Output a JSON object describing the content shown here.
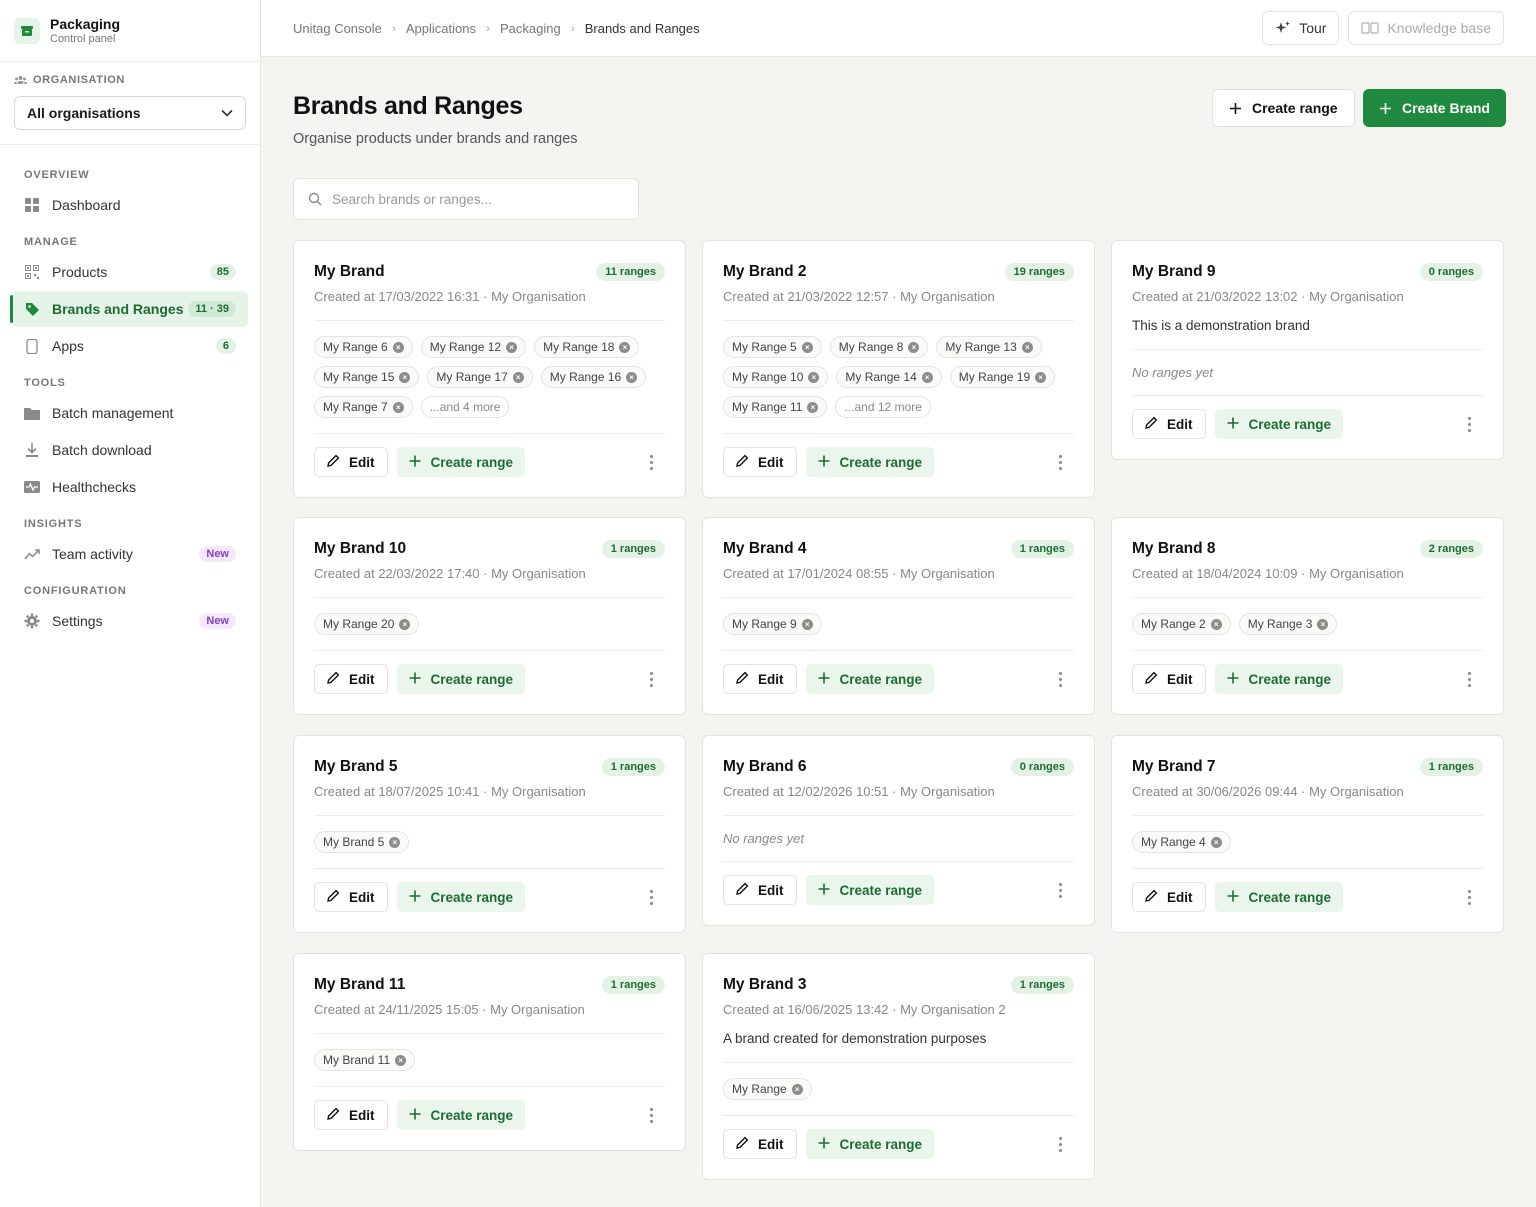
{
  "app": {
    "title": "Packaging",
    "subtitle": "Control panel"
  },
  "organisation": {
    "label": "ORGANISATION",
    "selected": "All organisations"
  },
  "nav": {
    "sections": [
      {
        "title": "OVERVIEW",
        "items": [
          {
            "label": "Dashboard",
            "icon": "dashboard-icon"
          }
        ]
      },
      {
        "title": "MANAGE",
        "items": [
          {
            "label": "Products",
            "icon": "qr-icon",
            "count": "85"
          },
          {
            "label": "Brands and Ranges",
            "icon": "tag-icon",
            "count": "11 · 39",
            "active": true
          },
          {
            "label": "Apps",
            "icon": "phone-icon",
            "count": "6"
          }
        ]
      },
      {
        "title": "TOOLS",
        "items": [
          {
            "label": "Batch management",
            "icon": "folder-icon"
          },
          {
            "label": "Batch download",
            "icon": "download-icon"
          },
          {
            "label": "Healthchecks",
            "icon": "pulse-icon"
          }
        ]
      },
      {
        "title": "INSIGHTS",
        "items": [
          {
            "label": "Team activity",
            "icon": "trend-icon",
            "badge": "New"
          }
        ]
      },
      {
        "title": "CONFIGURATION",
        "items": [
          {
            "label": "Settings",
            "icon": "gear-icon",
            "badge": "New"
          }
        ]
      }
    ]
  },
  "breadcrumb": [
    "Unitag Console",
    "Applications",
    "Packaging",
    "Brands and Ranges"
  ],
  "topbar": {
    "tour": "Tour",
    "knowledge": "Knowledge base"
  },
  "page": {
    "title": "Brands and Ranges",
    "subtitle": "Organise products under brands and ranges",
    "create_range": "Create range",
    "create_brand": "Create Brand",
    "search_placeholder": "Search brands or ranges..."
  },
  "card_labels": {
    "edit": "Edit",
    "create_range": "Create range"
  },
  "brands": [
    {
      "name": "My Brand",
      "ranges": "11 ranges",
      "meta": "Created at 17/03/2022 16:31 · My Organisation",
      "tags": [
        "My Range 6",
        "My Range 12",
        "My Range 18",
        "My Range 15",
        "My Range 17",
        "My Range 16",
        "My Range 7"
      ],
      "more": "...and 4 more"
    },
    {
      "name": "My Brand 2",
      "ranges": "19 ranges",
      "meta": "Created at 21/03/2022 12:57 · My Organisation",
      "tags": [
        "My Range 5",
        "My Range 8",
        "My Range 13",
        "My Range 10",
        "My Range 14",
        "My Range 19",
        "My Range 11"
      ],
      "more": "...and 12 more"
    },
    {
      "name": "My Brand 9",
      "ranges": "0 ranges",
      "meta": "Created at 21/03/2022 13:02 · My Organisation",
      "desc": "This is a demonstration brand",
      "tags": [],
      "empty": "No ranges yet"
    },
    {
      "name": "My Brand 10",
      "ranges": "1 ranges",
      "meta": "Created at 22/03/2022 17:40 · My Organisation",
      "tags": [
        "My Range 20"
      ]
    },
    {
      "name": "My Brand 4",
      "ranges": "1 ranges",
      "meta": "Created at 17/01/2024 08:55 · My Organisation",
      "tags": [
        "My Range 9"
      ]
    },
    {
      "name": "My Brand 8",
      "ranges": "2 ranges",
      "meta": "Created at 18/04/2024 10:09 · My Organisation",
      "tags": [
        "My Range 2",
        "My Range 3"
      ]
    },
    {
      "name": "My Brand 5",
      "ranges": "1 ranges",
      "meta": "Created at 18/07/2025 10:41 · My Organisation",
      "tags": [
        "My Brand 5"
      ]
    },
    {
      "name": "My Brand 6",
      "ranges": "0 ranges",
      "meta": "Created at 12/02/2026 10:51 · My Organisation",
      "tags": [],
      "empty": "No ranges yet"
    },
    {
      "name": "My Brand 7",
      "ranges": "1 ranges",
      "meta": "Created at 30/06/2026 09:44 · My Organisation",
      "tags": [
        "My Range 4"
      ]
    },
    {
      "name": "My Brand 11",
      "ranges": "1 ranges",
      "meta": "Created at 24/11/2025 15:05 · My Organisation",
      "tags": [
        "My Brand 11"
      ]
    },
    {
      "name": "My Brand 3",
      "ranges": "1 ranges",
      "meta": "Created at 16/06/2025 13:42 · My Organisation 2",
      "desc": "A brand created for demonstration purposes",
      "tags": [
        "My Range"
      ]
    }
  ],
  "colors": {
    "accent": "#1f8a3f",
    "accent_bg": "#e6f3e8",
    "new_badge": "#8a3fc7"
  }
}
